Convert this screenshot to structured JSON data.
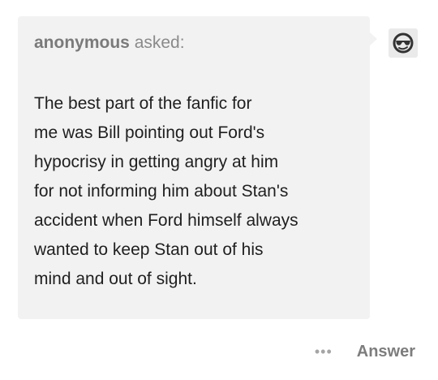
{
  "ask": {
    "asker_name": "anonymous",
    "asked_label": "asked:",
    "question": "The best part of the fanfic for\nme was Bill pointing out Ford's\nhypocrisy in getting angry at him\nfor not informing him about Stan's\naccident when Ford himself always\nwanted to keep Stan out of his\nmind and out of sight."
  },
  "avatar": {
    "icon": "anonymous-sunglasses-avatar-icon"
  },
  "footer": {
    "more_label": "•••",
    "answer_label": "Answer"
  },
  "colors": {
    "bubble_background": "#f2f2f2",
    "text": "#1f1f1f",
    "muted": "#8a8a8a"
  }
}
